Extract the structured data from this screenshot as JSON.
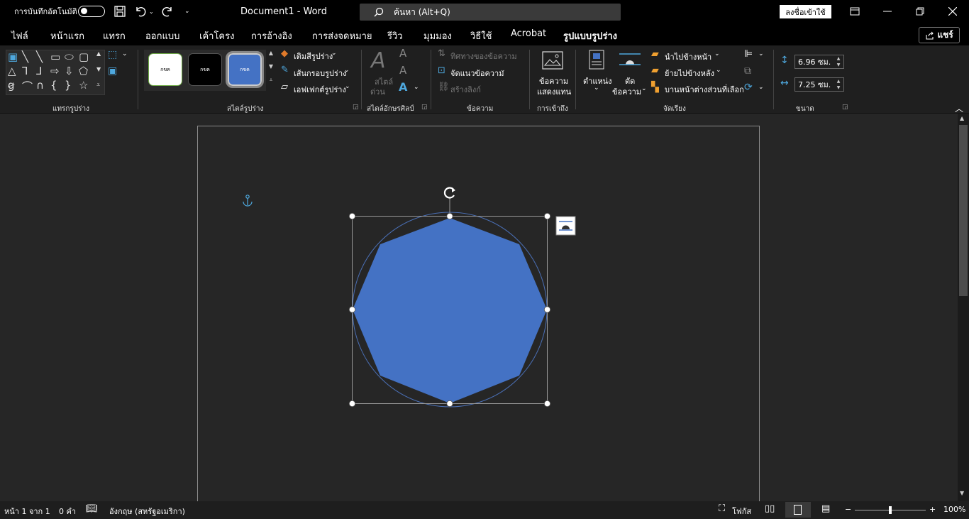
{
  "titlebar": {
    "autosave_label": "การบันทึกอัตโนมัติ",
    "doc_title": "Document1  -  Word",
    "search_placeholder": "ค้นหา (Alt+Q)",
    "signin_label": "ลงชื่อเข้าใช้"
  },
  "menu": {
    "tabs": [
      "ไฟล์",
      "หน้าแรก",
      "แทรก",
      "ออกแบบ",
      "เค้าโครง",
      "การอ้างอิง",
      "การส่งจดหมาย",
      "รีวิว",
      "มุมมอง",
      "วิธีใช้",
      "Acrobat",
      "รูปแบบรูปร่าง"
    ],
    "share_label": "แชร์"
  },
  "ribbon": {
    "groups": {
      "insert_shapes": "แทรกรูปร่าง",
      "shape_styles": "สไตล์รูปร่าง",
      "wordart_styles": "สไตล์อักษรศิลป์",
      "text": "ข้อความ",
      "accessibility": "การเข้าถึง",
      "arrange": "จัดเรียง",
      "size": "ขนาด"
    },
    "style_samples": [
      "กขค",
      "กขค",
      "กขค"
    ],
    "shape_fill": "เติมสีรูปร่าง",
    "shape_outline": "เส้นกรอบรูปร่าง",
    "shape_effects": "เอฟเฟกต์รูปร่าง",
    "quick_styles_1": "สไตล์",
    "quick_styles_2": "ด่วน",
    "text_direction": "ทิศทางของข้อความ",
    "align_text": "จัดแนวข้อความ",
    "create_link": "สร้างลิงก์",
    "alt_text_1": "ข้อความ",
    "alt_text_2": "แสดงแทน",
    "position": "ตำแหน่ง",
    "wrap_1": "ตัด",
    "wrap_2": "ข้อความ",
    "bring_forward": "นำไปข้างหน้า",
    "send_backward": "ย้ายไปข้างหลัง",
    "selection_pane": "บานหน้าต่างส่วนที่เลือก",
    "height_value": "6.96 ซม.",
    "width_value": "7.25 ซม."
  },
  "status": {
    "page": "หน้า 1 จาก 1",
    "words": "0 คำ",
    "language": "อังกฤษ (สหรัฐอเมริกา)",
    "focus": "โฟกัส",
    "zoom": "100%"
  },
  "colors": {
    "shape_fill": "#4472c4",
    "accent": "#4ea8de"
  }
}
